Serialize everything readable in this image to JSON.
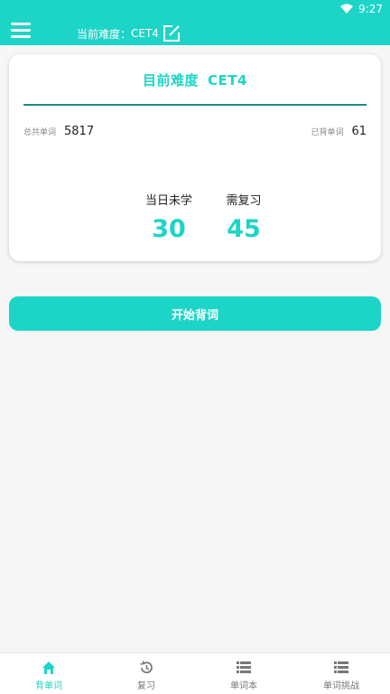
{
  "status_bar": {
    "time": "9:27",
    "wifi_icon": "wifi-icon"
  },
  "app_bar": {
    "menu_icon": "hamburger-menu-icon",
    "difficulty_label": "当前难度：",
    "difficulty_value": "CET4",
    "edit_icon": "edit-icon"
  },
  "card": {
    "title_label": "目前难度",
    "title_value": "CET4",
    "total_words_label": "总共单词",
    "total_words_value": "5817",
    "learned_label": "已背单词",
    "learned_value": "61",
    "today_unlearned_label": "当日未学",
    "today_unlearned_value": "30",
    "need_review_label": "需复习",
    "need_review_value": "45"
  },
  "start_button": {
    "label": "开始背词"
  },
  "bottom_nav": {
    "items": [
      {
        "label": "背单词",
        "icon": "home-icon",
        "active": true
      },
      {
        "label": "复习",
        "icon": "history-icon",
        "active": false
      },
      {
        "label": "单词本",
        "icon": "list-icon",
        "active": false
      },
      {
        "label": "单词挑战",
        "icon": "list-icon",
        "active": false
      }
    ]
  },
  "colors": {
    "accent": "#1dd5c7",
    "divider": "#168f8a",
    "background": "#f6f6f6"
  }
}
